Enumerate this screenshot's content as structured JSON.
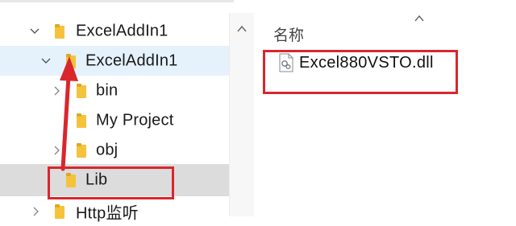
{
  "tree": {
    "items": [
      {
        "label": "ExcelAddIn1",
        "chevron": "down"
      },
      {
        "label": "ExcelAddIn1",
        "chevron": "down"
      },
      {
        "label": "bin",
        "chevron": "right"
      },
      {
        "label": "My Project",
        "chevron": "none"
      },
      {
        "label": "obj",
        "chevron": "right"
      },
      {
        "label": "Lib",
        "chevron": "none"
      },
      {
        "label": "Http监听",
        "chevron": "right"
      }
    ]
  },
  "file_list": {
    "column_header": "名称",
    "files": [
      {
        "name": "Excel880VSTO.dll",
        "icon": "dll-file-icon"
      }
    ]
  },
  "colors": {
    "selected_row": "#e5f1fb",
    "hover_row": "#dcdcdc",
    "folder_yellow": "#f5c33b",
    "annotation_red": "#d9262d"
  }
}
